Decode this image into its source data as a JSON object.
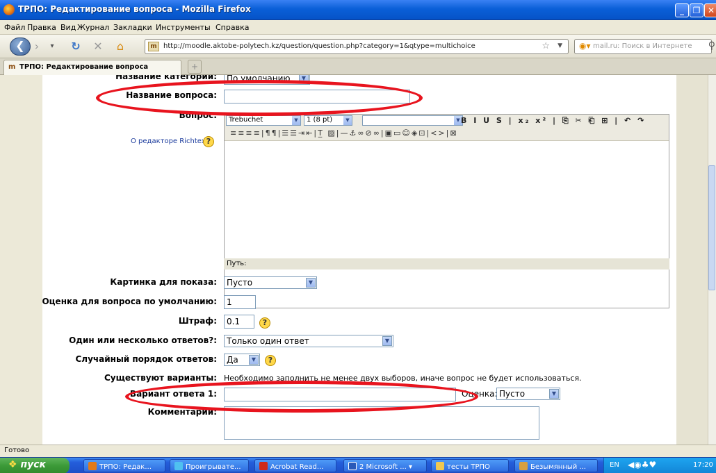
{
  "window": {
    "title": "ТРПО: Редактирование вопроса - Mozilla Firefox"
  },
  "menubar": {
    "items": [
      "Файл",
      "Правка",
      "Вид",
      "Журнал",
      "Закладки",
      "Инструменты",
      "Справка"
    ]
  },
  "nav": {
    "url": "http://moodle.aktobe-polytech.kz/question/question.php?category=1&qtype=multichoice",
    "search_placeholder": "mail.ru: Поиск в Интернете",
    "favicon": "m"
  },
  "tabs": [
    {
      "label": "ТРПО: Редактирование вопроса"
    }
  ],
  "form": {
    "category_label": "Название категории:",
    "category_value": "По умолчанию",
    "name_label": "Название вопроса:",
    "name_value": "",
    "question_label": "Вопрос:",
    "richtext_link": "О редакторе Richtext",
    "editor": {
      "font": "Trebuchet",
      "size": "1 (8 pt)",
      "path_label": "Путь:"
    },
    "image_label": "Картинка для показа:",
    "image_value": "Пусто",
    "default_grade_label": "Оценка для вопроса по умолчанию:",
    "default_grade_value": "1",
    "penalty_label": "Штраф:",
    "penalty_value": "0.1",
    "single_label": "Один или несколько ответов?:",
    "single_value": "Только один ответ",
    "shuffle_label": "Случайный порядок ответов:",
    "shuffle_value": "Да",
    "choices_label": "Существуют варианты:",
    "choices_text": "Необходимо заполнить не менее двух выборов, иначе вопрос не будет использоваться.",
    "answer1_label": "Вариант ответа 1:",
    "answer1_value": "",
    "grade_label": "Оценка:",
    "grade_value": "Пусто",
    "comment_label": "Комментарий:"
  },
  "status": {
    "text": "Готово"
  },
  "taskbar": {
    "start": "пуск",
    "buttons": [
      "ТРПО: Редак...",
      "Проигрывате...",
      "Acrobat Read...",
      "2 Microsoft ...",
      "тесты ТРПО",
      "Безымянный ..."
    ],
    "lang": "EN",
    "clock": "17:20"
  },
  "colors": {
    "highlight_oval": "#e8141e",
    "titlebar": "#0a5fd8",
    "taskbar": "#245edb"
  }
}
